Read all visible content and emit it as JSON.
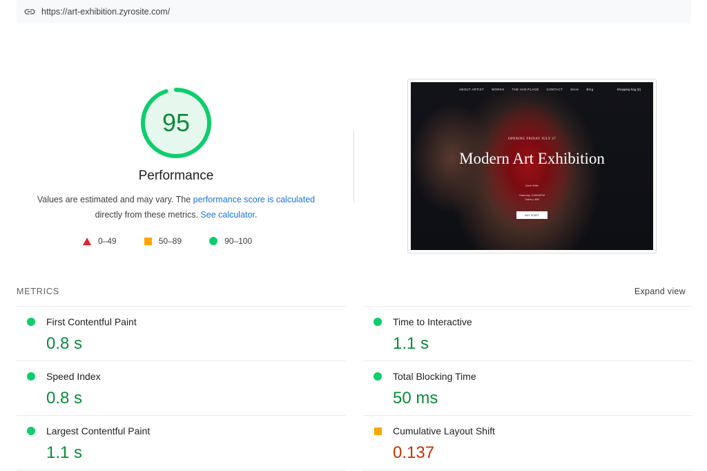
{
  "url_bar": {
    "url": "https://art-exhibition.zyrosite.com/",
    "icon": "link-icon"
  },
  "summary": {
    "score": "95",
    "score_fraction": 0.95,
    "score_color": "#0cce6b",
    "title": "Performance",
    "desc_1": "Values are estimated and may vary. The ",
    "desc_link_1": "performance score is calculated",
    "desc_2": " directly from these metrics. ",
    "desc_link_2": "See calculator",
    "desc_3": "."
  },
  "legend": [
    {
      "label": "0–49",
      "icon": "fail-triangle-icon",
      "color": "#e8202a"
    },
    {
      "label": "50–89",
      "icon": "average-square-icon",
      "color": "#ffa400"
    },
    {
      "label": "90–100",
      "icon": "pass-circle-icon",
      "color": "#0cce6b"
    }
  ],
  "screenshot": {
    "nav": [
      "ABOUT ARTIST",
      "WORKS",
      "THE VAN PLACE",
      "CONTACT",
      "Store",
      "Blog"
    ],
    "cart": "Shopping bag (0)",
    "eyebrow": "OPENING FRIDAY JULY 27",
    "headline": "Modern Art Exhibition",
    "small1": "Dear Willa",
    "small2a": "Saturday 10AM/6PM",
    "small2b": "Gallery 45B",
    "button": "BUY TICKET"
  },
  "metrics_header": {
    "label": "METRICS",
    "expand": "Expand view"
  },
  "metrics": [
    {
      "name": "First Contentful Paint",
      "value": "0.8 s",
      "status": "pass"
    },
    {
      "name": "Time to Interactive",
      "value": "1.1 s",
      "status": "pass"
    },
    {
      "name": "Speed Index",
      "value": "0.8 s",
      "status": "pass"
    },
    {
      "name": "Total Blocking Time",
      "value": "50 ms",
      "status": "pass"
    },
    {
      "name": "Largest Contentful Paint",
      "value": "1.1 s",
      "status": "pass"
    },
    {
      "name": "Cumulative Layout Shift",
      "value": "0.137",
      "status": "average"
    }
  ]
}
